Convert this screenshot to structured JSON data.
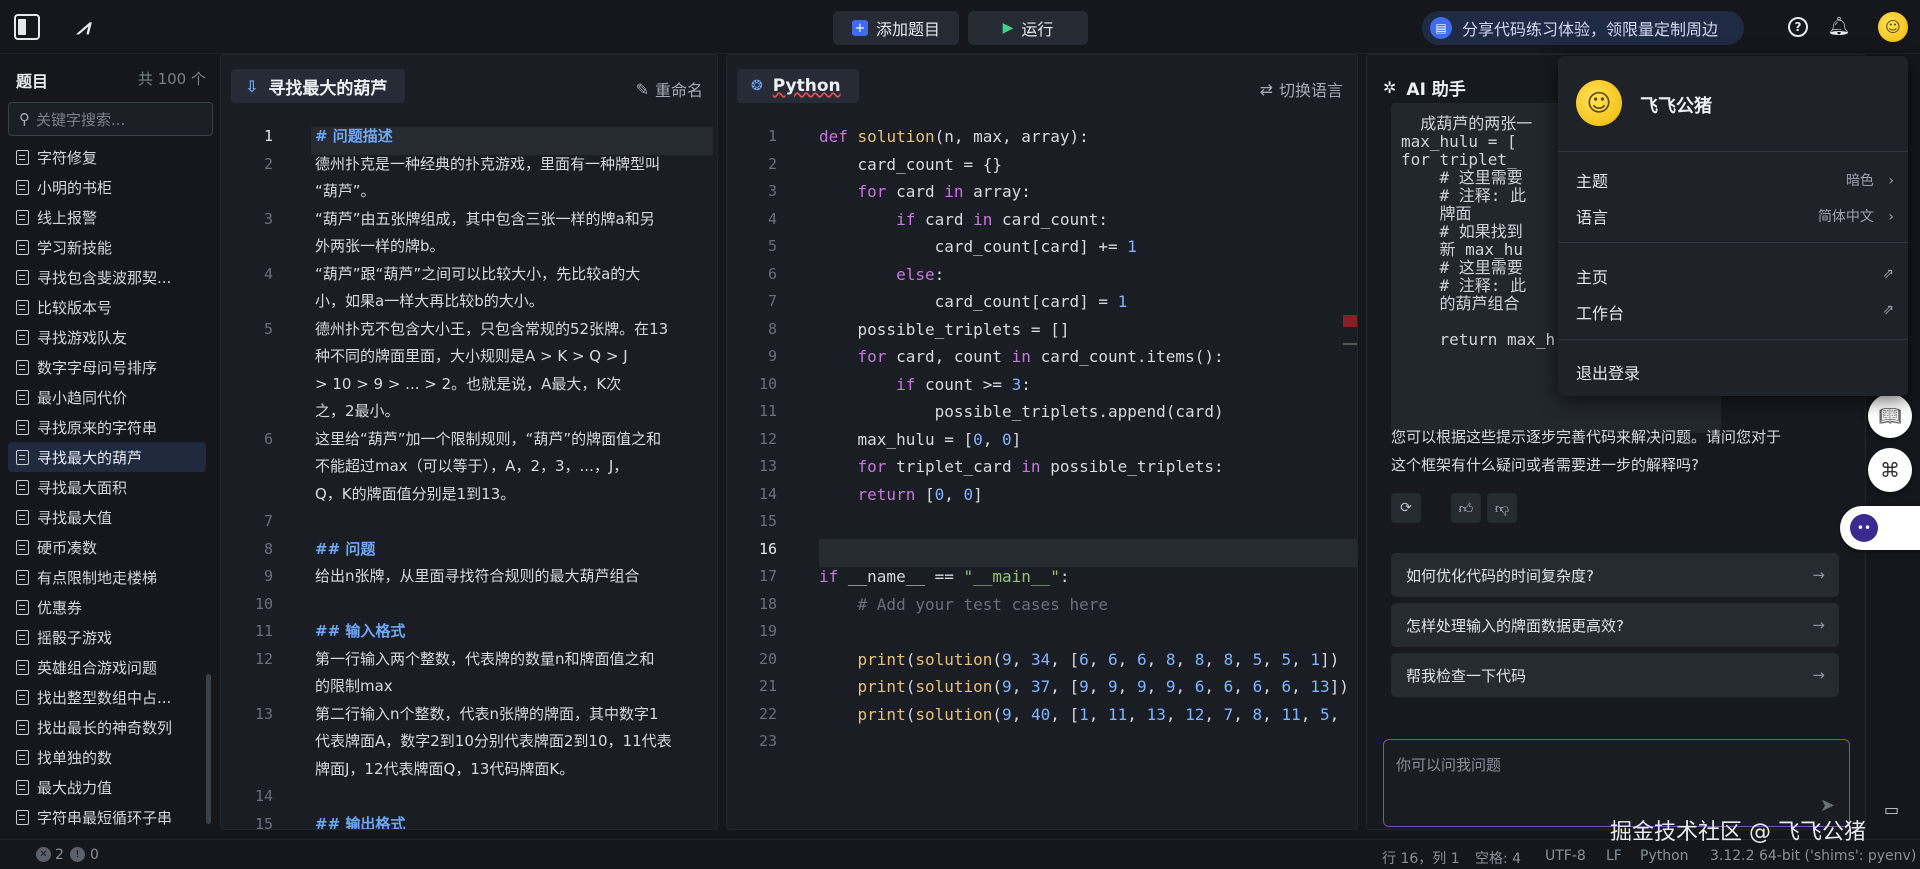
{
  "topbar": {
    "add_problem": "添加题目",
    "run": "运行",
    "promo": "分享代码练习体验，领限量定制周边"
  },
  "sidebar": {
    "title": "题目",
    "count": "共 100 个",
    "search_placeholder": "关键字搜索...",
    "items": [
      "字符修复",
      "小明的书柜",
      "线上报警",
      "学习新技能",
      "寻找包含斐波那契...",
      "比较版本号",
      "寻找游戏队友",
      "数字字母问号排序",
      "最小趋同代价",
      "寻找原来的字符串",
      "寻找最大的葫芦",
      "寻找最大面积",
      "寻找最大值",
      "硬币凑数",
      "有点限制地走楼梯",
      "优惠券",
      "摇骰子游戏",
      "英雄组合游戏问题",
      "找出整型数组中占...",
      "找出最长的神奇数列",
      "找单独的数",
      "最大战力值",
      "字符串最短循环子串"
    ],
    "active_index": 10
  },
  "problem": {
    "tab": "寻找最大的葫芦",
    "rename": "重命名",
    "lines": [
      {
        "n": "1",
        "t": "# 问题描述",
        "h": true
      },
      {
        "n": "2",
        "t": "德州扑克是一种经典的扑克游戏，里面有一种牌型叫"
      },
      {
        "n": "",
        "t": "“葫芦”。"
      },
      {
        "n": "3",
        "t": "“葫芦”由五张牌组成，其中包含三张一样的牌a和另"
      },
      {
        "n": "",
        "t": "外两张一样的牌b。"
      },
      {
        "n": "4",
        "t": "“葫芦”跟“葫芦”之间可以比较大小，先比较a的大"
      },
      {
        "n": "",
        "t": "小，如果a一样大再比较b的大小。"
      },
      {
        "n": "5",
        "t": "德州扑克不包含大小王，只包含常规的52张牌。在13"
      },
      {
        "n": "",
        "t": "种不同的牌面里面，大小规则是A > K > Q > J"
      },
      {
        "n": "",
        "t": "> 10 > 9 > ... > 2。也就是说，A最大，K次"
      },
      {
        "n": "",
        "t": "之，2最小。"
      },
      {
        "n": "6",
        "t": "这里给“葫芦”加一个限制规则，“葫芦”的牌面值之和"
      },
      {
        "n": "",
        "t": "不能超过max（可以等于），A，2，3，...，J，"
      },
      {
        "n": "",
        "t": "Q，K的牌面值分别是1到13。"
      },
      {
        "n": "7",
        "t": ""
      },
      {
        "n": "8",
        "t": "## 问题",
        "h": true
      },
      {
        "n": "9",
        "t": "给出n张牌，从里面寻找符合规则的最大葫芦组合"
      },
      {
        "n": "10",
        "t": ""
      },
      {
        "n": "11",
        "t": "## 输入格式",
        "h": true
      },
      {
        "n": "12",
        "t": "第一行输入两个整数，代表牌的数量n和牌面值之和"
      },
      {
        "n": "",
        "t": "的限制max"
      },
      {
        "n": "13",
        "t": "第二行输入n个整数，代表n张牌的牌面，其中数字1"
      },
      {
        "n": "",
        "t": "代表牌面A，数字2到10分别代表牌面2到10，11代表"
      },
      {
        "n": "",
        "t": "牌面J，12代表牌面Q，13代码牌面K。"
      },
      {
        "n": "14",
        "t": ""
      },
      {
        "n": "15",
        "t": "## 输出格式",
        "h": true
      }
    ]
  },
  "editor": {
    "tab": "Python",
    "switch_lang": "切换语言",
    "lines": [
      {
        "n": "1",
        "t": "def solution(n, max, array):"
      },
      {
        "n": "2",
        "t": "    card_count = {}"
      },
      {
        "n": "3",
        "t": "    for card in array:"
      },
      {
        "n": "4",
        "t": "        if card in card_count:"
      },
      {
        "n": "5",
        "t": "            card_count[card] += 1"
      },
      {
        "n": "6",
        "t": "        else:"
      },
      {
        "n": "7",
        "t": "            card_count[card] = 1"
      },
      {
        "n": "8",
        "t": "    possible_triplets = []"
      },
      {
        "n": "9",
        "t": "    for card, count in card_count.items():"
      },
      {
        "n": "10",
        "t": "        if count >= 3:"
      },
      {
        "n": "11",
        "t": "            possible_triplets.append(card)"
      },
      {
        "n": "12",
        "t": "    max_hulu = [0, 0]"
      },
      {
        "n": "13",
        "t": "    for triplet_card in possible_triplets:"
      },
      {
        "n": "14",
        "t": "    return [0, 0]"
      },
      {
        "n": "15",
        "t": ""
      },
      {
        "n": "16",
        "t": ""
      },
      {
        "n": "17",
        "t": "if __name__ == \"__main__\":"
      },
      {
        "n": "18",
        "t": "    # Add your test cases here"
      },
      {
        "n": "19",
        "t": ""
      },
      {
        "n": "20",
        "t": "    print(solution(9, 34, [6, 6, 6, 8, 8, 8, 5, 5, 1])"
      },
      {
        "n": "21",
        "t": "    print(solution(9, 37, [9, 9, 9, 9, 6, 6, 6, 6, 13])"
      },
      {
        "n": "22",
        "t": "    print(solution(9, 40, [1, 11, 13, 12, 7, 8, 11, 5,"
      },
      {
        "n": "23",
        "t": ""
      }
    ],
    "current_line": "16"
  },
  "ai": {
    "title": "AI 助手",
    "code_snippet": "  成葫芦的两张一\nmax_hulu = [\nfor triplet_\n    # 这里需要\n    # 注释: 此\n    牌面\n    # 如果找到\n    新 max_hu\n    # 这里需要\n    # 注释: 此\n    的葫芦组合\n\n    return max_h",
    "message": "您可以根据这些提示逐步完善代码来解决问题。请问您对于这个框架有什么疑问或者需要进一步的解释吗?",
    "suggestions": [
      "如何优化代码的时间复杂度?",
      "怎样处理输入的牌面数据更高效?",
      "帮我检查一下代码"
    ],
    "input_placeholder": "你可以问我问题"
  },
  "user_menu": {
    "name": "飞飞公猪",
    "theme_label": "主题",
    "theme_value": "暗色",
    "lang_label": "语言",
    "lang_value": "简体中文",
    "home": "主页",
    "workbench": "工作台",
    "logout": "退出登录"
  },
  "status": {
    "errors": "2",
    "warnings": "0",
    "position": "行 16，列 1",
    "spaces": "空格: 4",
    "encoding": "UTF-8",
    "eol": "LF",
    "language": "Python",
    "interpreter": "3.12.2 64-bit ('shims': pyenv)"
  },
  "watermark": "掘金技术社区 @ 飞飞公猪",
  "colors": {
    "accent": "#3d6cf0",
    "heading": "#6ea8f5",
    "keyword": "#c678dd",
    "string": "#98c379",
    "number": "#7fb5ff"
  }
}
